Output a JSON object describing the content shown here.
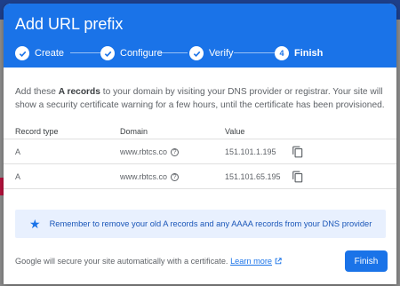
{
  "background": {
    "partial_text": ""
  },
  "dialog": {
    "title": "Add URL prefix",
    "steps": [
      {
        "label": "Create",
        "state": "done",
        "icon": "check-icon"
      },
      {
        "label": "Configure",
        "state": "done",
        "icon": "check-icon"
      },
      {
        "label": "Verify",
        "state": "done",
        "icon": "check-icon"
      },
      {
        "label": "Finish",
        "state": "active",
        "number": "4"
      }
    ],
    "description_parts": {
      "pre": "Add these ",
      "bold": "A records",
      "post": " to your domain by visiting your DNS provider or registrar. Your site will show a security certificate warning for a few hours, until the certificate has been provisioned."
    },
    "table": {
      "headers": {
        "type": "Record type",
        "domain": "Domain",
        "value": "Value"
      },
      "rows": [
        {
          "type": "A",
          "domain": "www.rbtcs.co",
          "value": "151.101.1.195"
        },
        {
          "type": "A",
          "domain": "www.rbtcs.co",
          "value": "151.101.65.195"
        }
      ]
    },
    "notice": "Remember to remove your old A records and any AAAA records from your DNS provider",
    "footer": {
      "text": "Google will secure your site automatically with a certificate.",
      "link": "Learn more"
    },
    "finish_button": "Finish"
  },
  "colors": {
    "primary": "#1a73e8",
    "notice_bg": "#e8f0fe"
  }
}
